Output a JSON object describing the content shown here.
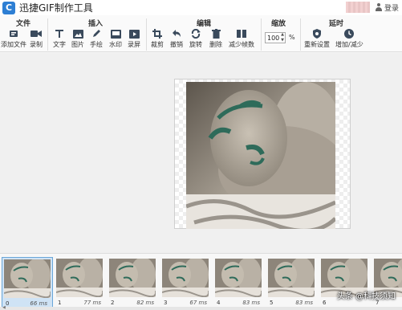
{
  "app": {
    "title": "迅捷GIF制作工具",
    "logo_letter": "C"
  },
  "titlebar": {
    "login_label": "登录"
  },
  "toolbar": {
    "groups": {
      "file": "文件",
      "insert": "插入",
      "edit": "编辑",
      "zoom": "缩放",
      "delay": "延时"
    },
    "tools": {
      "add_file": "添加文件",
      "record": "录制",
      "text": "文字",
      "image": "图片",
      "handdraw": "手绘",
      "watermark": "水印",
      "record_screen": "录屏",
      "crop": "裁剪",
      "undo": "撤销",
      "rotate": "旋转",
      "delete": "删除",
      "reduce_frames": "减少帧数",
      "reset": "重新设置",
      "increase_decrease": "增加/减少"
    },
    "zoom_value": "100",
    "zoom_unit": "%"
  },
  "frames": [
    {
      "index": "0",
      "ms": "66 ms"
    },
    {
      "index": "1",
      "ms": "77 ms"
    },
    {
      "index": "2",
      "ms": "82 ms"
    },
    {
      "index": "3",
      "ms": "67 ms"
    },
    {
      "index": "4",
      "ms": "83 ms"
    },
    {
      "index": "5",
      "ms": "83 ms"
    },
    {
      "index": "6",
      "ms": ""
    },
    {
      "index": "7",
      "ms": ""
    }
  ],
  "overlay": {
    "watermark_text": "头条 @科技须知"
  },
  "colors": {
    "accent": "#2d7fd4",
    "selected_frame": "#cfe3f5",
    "icon": "#3a4a5c"
  }
}
